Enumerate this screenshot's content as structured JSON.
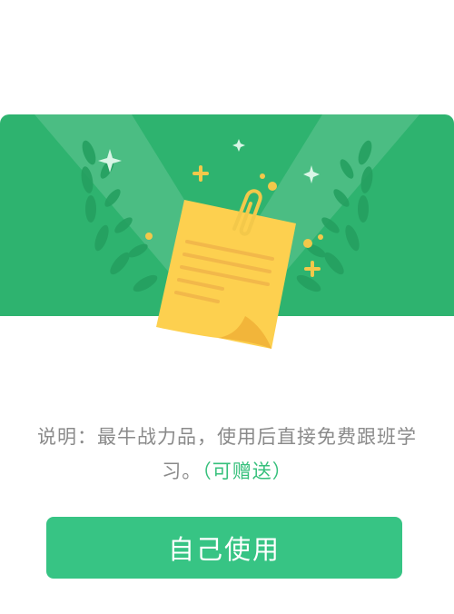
{
  "card": {
    "description_text": "说明：最牛战力品，使用后直接免费跟班学习。",
    "gift_note": "（可赠送）",
    "use_button_label": "自己使用"
  },
  "colors": {
    "banner_green": "#2eb36f",
    "button_green": "#37c484",
    "gift_green": "#37c07c",
    "text_gray": "#8a8a8a",
    "note_yellow": "#fdd04f"
  },
  "icons": [
    "note-paper-icon",
    "paperclip-icon",
    "laurel-icon",
    "sparkle-icon"
  ]
}
